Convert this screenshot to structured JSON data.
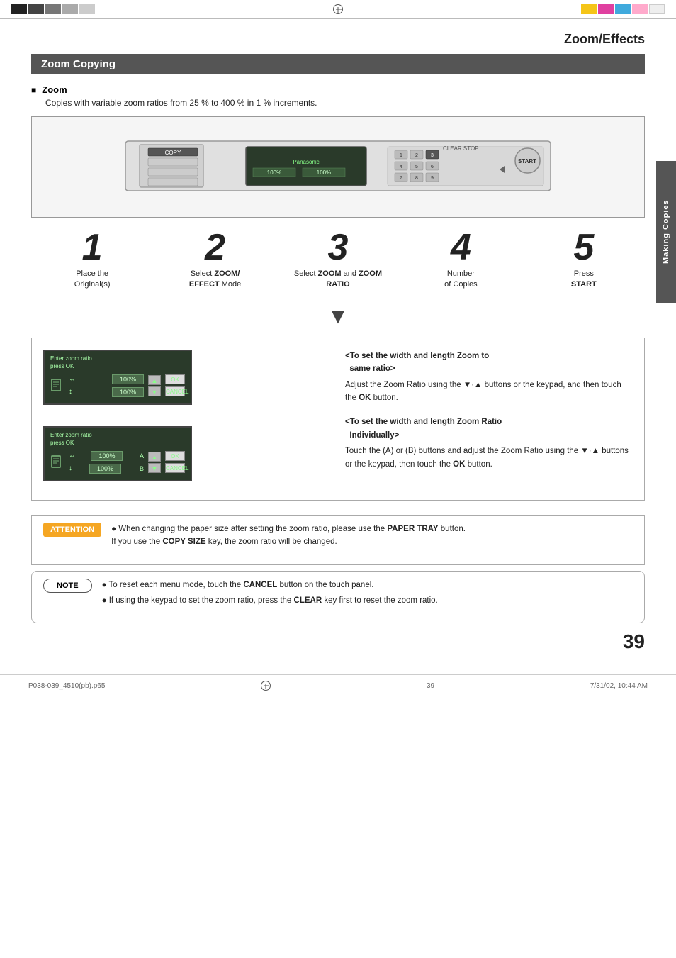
{
  "page": {
    "title": "Zoom/Effects",
    "section": "Zoom Copying",
    "sidebar_label": "Making Copies",
    "page_number": "39",
    "bottom_left": "P038-039_4510(pb).p65",
    "bottom_center": "39",
    "bottom_right": "7/31/02, 10:44 AM"
  },
  "top_colors_left": [
    "#222",
    "#444",
    "#666",
    "#888",
    "#aaa",
    "#bbb",
    "#ccc"
  ],
  "top_colors_right": [
    "#f5c518",
    "#e040a0",
    "#40aadd",
    "#ffaacc",
    "#eee",
    "#eee",
    "#eee"
  ],
  "zoom": {
    "subtitle": "Zoom",
    "description": "Copies with variable zoom ratios from 25 % to 400 % in 1 % increments.",
    "steps": [
      {
        "number": "1",
        "label_html": "Place the\nOriginal(s)"
      },
      {
        "number": "2",
        "label_html": "Select ZOOM/\nEFFECT Mode"
      },
      {
        "number": "3",
        "label_html": "Select ZOOM and ZOOM\nRATIO"
      },
      {
        "number": "4",
        "label_html": "Number\nof Copies"
      },
      {
        "number": "5",
        "label_html": "Press\nSTART"
      }
    ]
  },
  "lcd_panel1": {
    "enter_text": "Enter zoom ratio",
    "press_ok": "press OK",
    "row1_icon": "↔",
    "row1_value": "100%",
    "row2_icon": "↕",
    "row2_value": "100%",
    "ok_label": "OK",
    "cancel_label": "CANCEL"
  },
  "lcd_panel2": {
    "enter_text": "Enter zoom ratio",
    "press_ok": "press OK",
    "row1_icon": "↔",
    "row1_value": "100%",
    "row1_tag": "A",
    "row2_icon": "↕",
    "row2_value": "100%",
    "row2_tag": "B",
    "ok_label": "OK",
    "cancel_label": "CANCEL"
  },
  "panel_right": {
    "section1": {
      "title": "<To set the width and length Zoom to same ratio>",
      "body": "Adjust the Zoom Ratio using the ▼·▲ buttons or the keypad, and then touch the OK button."
    },
    "section2": {
      "title": "<To set the width and length Zoom Ratio Individually>",
      "body": "Touch the (A) or (B) buttons and adjust the Zoom Ratio using the ▼·▲ buttons or the keypad, then touch the OK button."
    }
  },
  "attention": {
    "label": "ATTENTION",
    "bullet1_html": "When changing the paper size after setting the zoom ratio, please use the PAPER TRAY button.\nIf you use the COPY SIZE key, the zoom ratio will be changed."
  },
  "note": {
    "label": "NOTE",
    "bullet1_html": "To reset each menu mode, touch the CANCEL button on the touch panel.",
    "bullet2_html": "If using the keypad to set the zoom ratio, press the CLEAR key first to reset the zoom ratio."
  }
}
